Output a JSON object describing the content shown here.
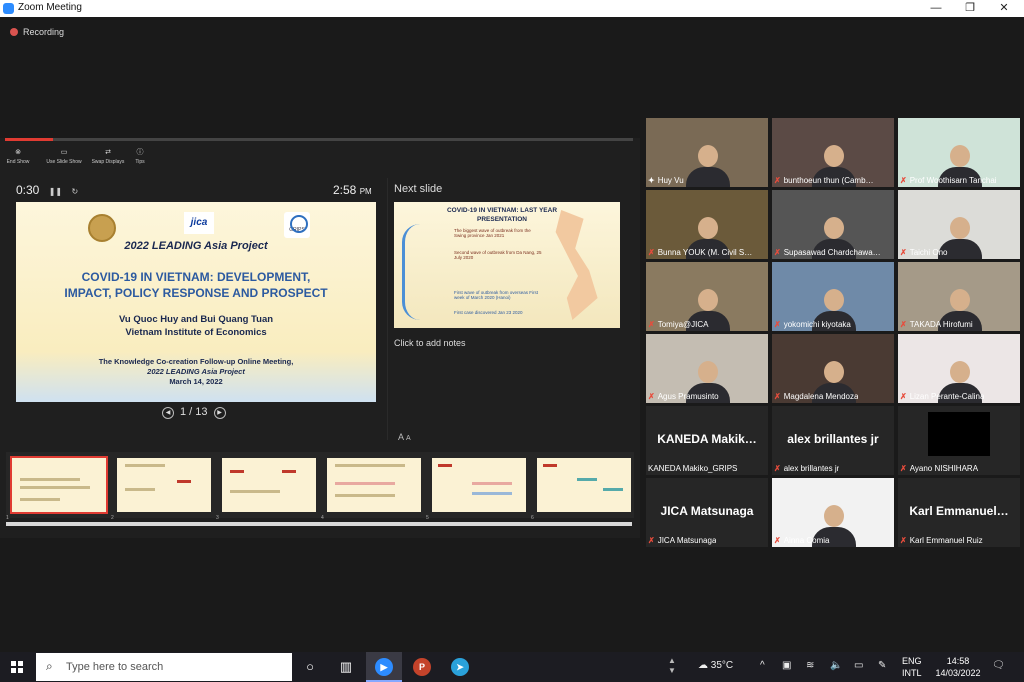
{
  "window": {
    "title": "Zoom Meeting",
    "minimize": "—",
    "restore": "❐",
    "close": "✕"
  },
  "recording": {
    "label": "Recording"
  },
  "presenter": {
    "tools": [
      {
        "icon": "⊗",
        "label": "End Show"
      },
      {
        "icon": "▭",
        "label": "Use Slide Show"
      },
      {
        "icon": "⇄",
        "label": "Swap Displays"
      },
      {
        "icon": "ⓘ",
        "label": "Tips"
      }
    ],
    "elapsed": "0:30",
    "pause_icon": "❚❚",
    "reset_icon": "↻",
    "clock": "2:58",
    "clock_ampm": "PM",
    "slide": {
      "jica": "jica",
      "grips": "GRIPS",
      "project": "2022 LEADING Asia Project",
      "title_line1": "COVID-19 IN VIETNAM: DEVELOPMENT,",
      "title_line2": "IMPACT, POLICY RESPONSE AND PROSPECT",
      "authors": "Vu Quoc Huy and Bui Quang Tuan",
      "institute": "Vietnam Institute of Economics",
      "meeting_line1": "The Knowledge Co-creation Follow-up Online Meeting,",
      "meeting_line2": "2022 LEADING Asia Project",
      "meeting_date": "March 14, 2022"
    },
    "nav": {
      "prev": "◀",
      "page": "1 / 13",
      "next": "▶"
    },
    "next_slide_label": "Next slide",
    "next_slide": {
      "title": "COVID-19 IN VIETNAM: LAST YEAR PRESENTATION",
      "notes": [
        "The biggest wave of outbreak from the Swing province Jan 2021",
        "Second wave of outbreak from Da Nang, 25 July 2020",
        "First wave of outbreak from overseas First week of March 2020 (Hanoi)",
        "First case discovered Jan 23 2020"
      ]
    },
    "notes_placeholder": "Click to add notes",
    "font_increase": "A",
    "font_decrease": "A",
    "thumbnails": [
      {
        "num": "1"
      },
      {
        "num": "2"
      },
      {
        "num": "3"
      },
      {
        "num": "4"
      },
      {
        "num": "5"
      },
      {
        "num": "6"
      }
    ]
  },
  "participants": [
    {
      "name": "Huy Vu",
      "muted": false,
      "active": true,
      "video": true,
      "bg": "#7a6a55"
    },
    {
      "name": "bunthoeun thun (Camb…",
      "muted": true,
      "video": true,
      "bg": "#5b4a45"
    },
    {
      "name": "Prof Woothisarn Tanchai",
      "muted": true,
      "video": true,
      "bg": "#cfe3d8"
    },
    {
      "name": "Bunna YOUK (M. Civil S…",
      "muted": true,
      "video": true,
      "bg": "#6b5a3a"
    },
    {
      "name": "Supasawad Chardchawa…",
      "muted": true,
      "video": true,
      "bg": "#555555"
    },
    {
      "name": "Taichi Ono",
      "muted": true,
      "video": true,
      "bg": "#dcdcd8"
    },
    {
      "name": "Tomiya@JICA",
      "muted": true,
      "video": true,
      "bg": "#8a7a60"
    },
    {
      "name": "yokomichi kiyotaka",
      "muted": true,
      "video": true,
      "bg": "#6f8aa8"
    },
    {
      "name": "TAKADA Hirofumi",
      "muted": true,
      "video": true,
      "bg": "#a59a88"
    },
    {
      "name": "Agus Pramusinto",
      "muted": true,
      "video": true,
      "bg": "#c4bdb2"
    },
    {
      "name": "Magdalena Mendoza",
      "muted": true,
      "video": true,
      "bg": "#4a3a33"
    },
    {
      "name": "Lizan Perante-Calina",
      "muted": true,
      "video": true,
      "bg": "#ece6e6"
    },
    {
      "name": "KANEDA Makiko_GRIPS",
      "big": "KANEDA  Makik…",
      "muted": false,
      "video": false
    },
    {
      "name": "alex brillantes jr",
      "big": "alex brillantes jr",
      "muted": true,
      "video": false
    },
    {
      "name": "Ayano NISHIHARA",
      "muted": true,
      "video": false,
      "black": true
    },
    {
      "name": "JICA Matsunaga",
      "big": "JICA Matsunaga",
      "muted": true,
      "video": false
    },
    {
      "name": "Ainna Comia",
      "muted": true,
      "video": true,
      "bg": "#f2f2f2"
    },
    {
      "name": "Karl Emmanuel Ruiz",
      "big": "Karl  Emmanuel…",
      "muted": true,
      "video": false
    }
  ],
  "taskbar": {
    "search_placeholder": "Type here to search",
    "search_icon": "⌕",
    "weather": "35°C",
    "lang_top": "ENG",
    "lang_bottom": "INTL",
    "time": "14:58",
    "date": "14/03/2022",
    "apps": [
      {
        "name": "zoom",
        "glyph": "▶",
        "color": "#2d8cff"
      },
      {
        "name": "powerpoint",
        "glyph": "P",
        "color": "#c4432b"
      },
      {
        "name": "telegram",
        "glyph": "➤",
        "color": "#2aa1da"
      }
    ]
  }
}
